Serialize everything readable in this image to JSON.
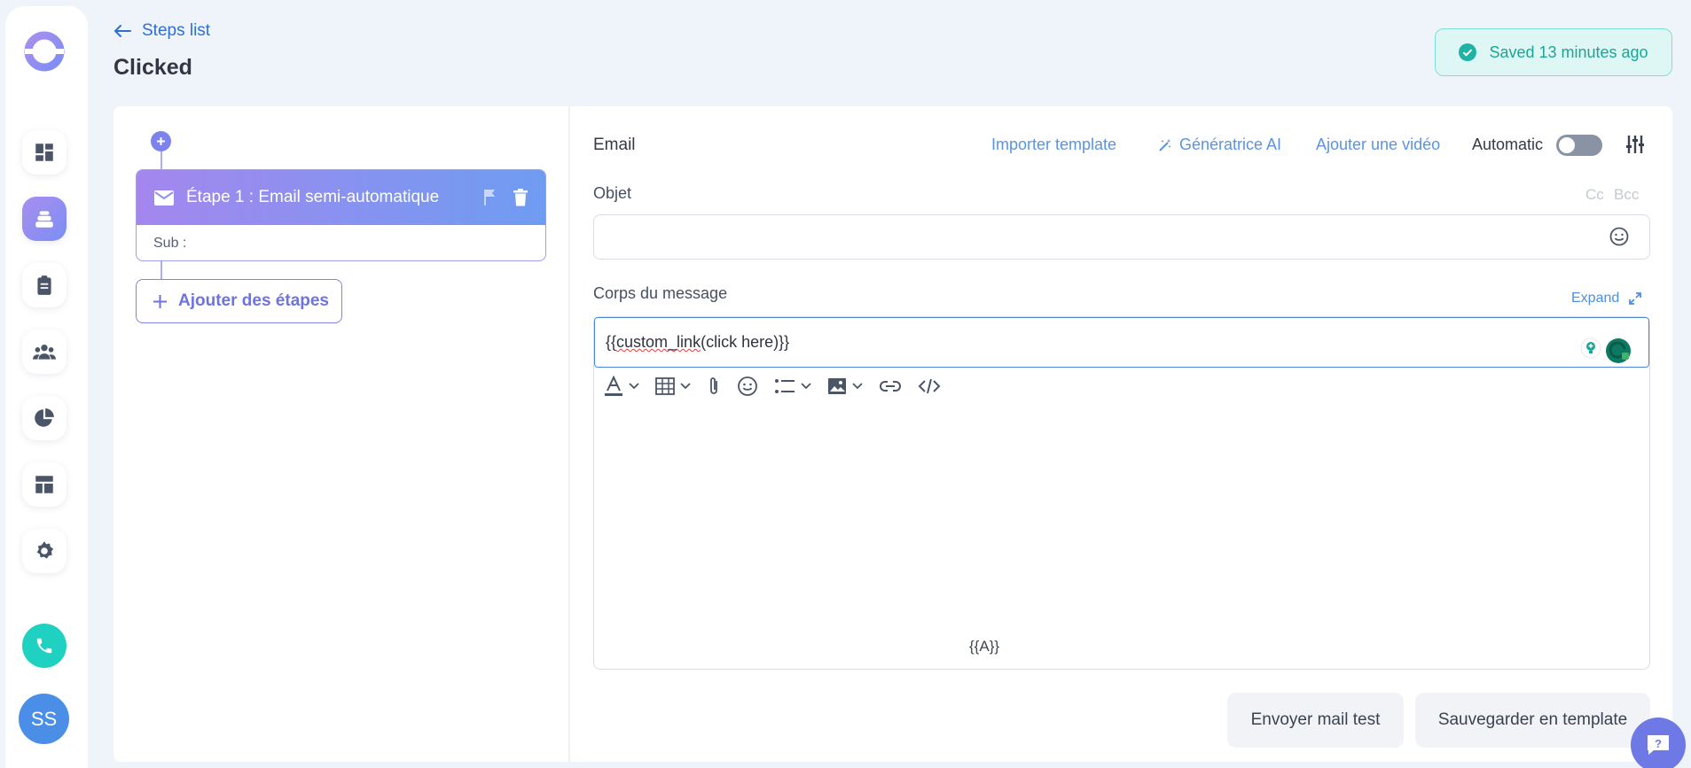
{
  "header": {
    "back_label": "Steps list",
    "title": "Clicked",
    "saved_status": "Saved 13 minutes ago"
  },
  "sidebar": {
    "items": [
      {
        "icon": "dashboard-icon"
      },
      {
        "icon": "inbox-stack-icon",
        "active": true
      },
      {
        "icon": "clipboard-icon"
      },
      {
        "icon": "team-icon"
      },
      {
        "icon": "pie-chart-icon"
      },
      {
        "icon": "layout-icon"
      },
      {
        "icon": "gear-icon"
      }
    ],
    "avatar_initials": "SS"
  },
  "steps": {
    "step1_title": "Étape 1 : Email semi-automatique",
    "step1_sub": "Sub :",
    "add_steps_label": "Ajouter des étapes"
  },
  "editor": {
    "section_title": "Email",
    "import_template": "Importer template",
    "ai_generator": "Génératrice AI",
    "add_video": "Ajouter une vidéo",
    "automatic_label": "Automatic",
    "automatic_on": false,
    "subject_label": "Objet",
    "subject_value": "",
    "cc_label": "Cc",
    "bcc_label": "Bcc",
    "body_label": "Corps du message",
    "expand_label": "Expand",
    "body_prefix": "{{",
    "body_squiggle": "custom_link",
    "body_suffix": "(click here)}}",
    "variable_label": "{{A}}"
  },
  "actions": {
    "send_test": "Envoyer mail test",
    "save_template": "Sauvegarder en template"
  },
  "colors": {
    "accent": "#7b8ef3",
    "link": "#5b93e4",
    "saved_green": "#1aa597",
    "phone": "#1fd1c1"
  }
}
